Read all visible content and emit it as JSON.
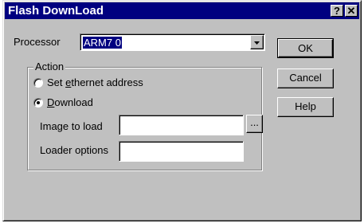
{
  "window": {
    "title": "Flash DownLoad",
    "help_glyph": "?",
    "close_glyph": "✕"
  },
  "processor": {
    "label": "Processor",
    "value": "ARM7 0"
  },
  "action": {
    "group_label": "Action",
    "set_ethernet": {
      "prefix": "Set ",
      "accel": "e",
      "suffix": "thernet address",
      "selected": false
    },
    "download": {
      "accel": "D",
      "suffix": "ownload",
      "selected": true
    }
  },
  "image_to_load": {
    "label": "Image to load",
    "value": "",
    "browse_label": "..."
  },
  "loader_options": {
    "label": "Loader options",
    "value": ""
  },
  "buttons": {
    "ok": "OK",
    "cancel": "Cancel",
    "help": "Help"
  },
  "icons": {
    "dropdown": "dropdown-arrow-icon"
  },
  "colors": {
    "titlebar": "#000080",
    "face": "#c0c0c0",
    "selection": "#000080"
  }
}
